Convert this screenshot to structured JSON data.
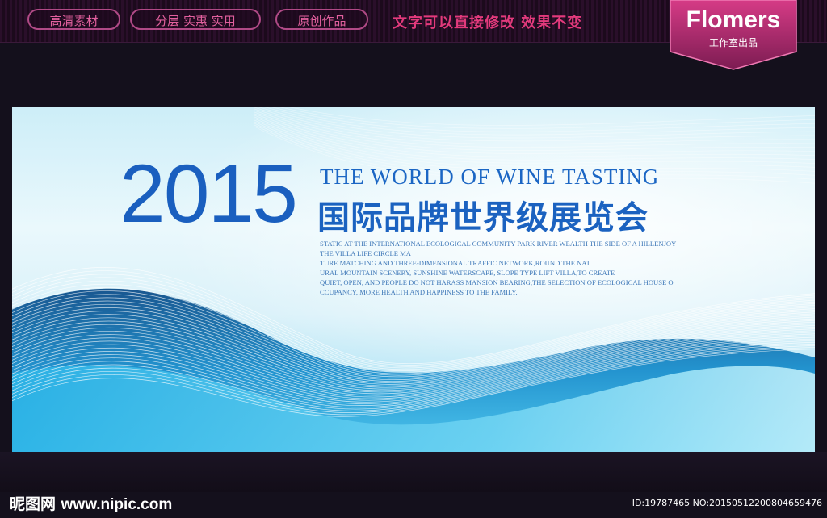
{
  "topbar": {
    "tags": [
      "高清素材",
      "分层 实惠 实用",
      "原创作品"
    ],
    "promo": "文字可以直接修改  效果不变",
    "brand_name": "Flomers",
    "brand_sub": "工作室出品"
  },
  "banner": {
    "year": "2015",
    "headline_en": "THE WORLD OF WINE TASTING",
    "headline_cn": "国际品牌世界级展览会",
    "paragraph": [
      "STATIC AT THE INTERNATIONAL ECOLOGICAL COMMUNITY PARK RIVER WEALTH THE SIDE OF A HILLENJOY",
      "THE VILLA LIFE CIRCLE MA",
      "TURE MATCHING AND THREE-DIMENSIONAL TRAFFIC NETWORK,ROUND THE NAT",
      "URAL MOUNTAIN SCENERY, SUNSHINE WATERSCAPE, SLOPE TYPE LIFT VILLA,TO CREATE",
      "QUIET, OPEN, AND PEOPLE DO NOT HARASS MANSION BEARING,THE SELECTION OF ECOLOGICAL HOUSE O",
      "CCUPANCY, MORE HEALTH AND HAPPINESS TO THE FAMILY."
    ]
  },
  "footer": {
    "logo": "昵图网",
    "site": "www.nipic.com",
    "id_text": "ID:19787465 NO:20150512200804659476"
  },
  "colors": {
    "accent_pink": "#e33a7c",
    "title_blue": "#1a5fbf",
    "banner_light": "#e6f7fc",
    "banner_deep": "#1ba6d8"
  }
}
